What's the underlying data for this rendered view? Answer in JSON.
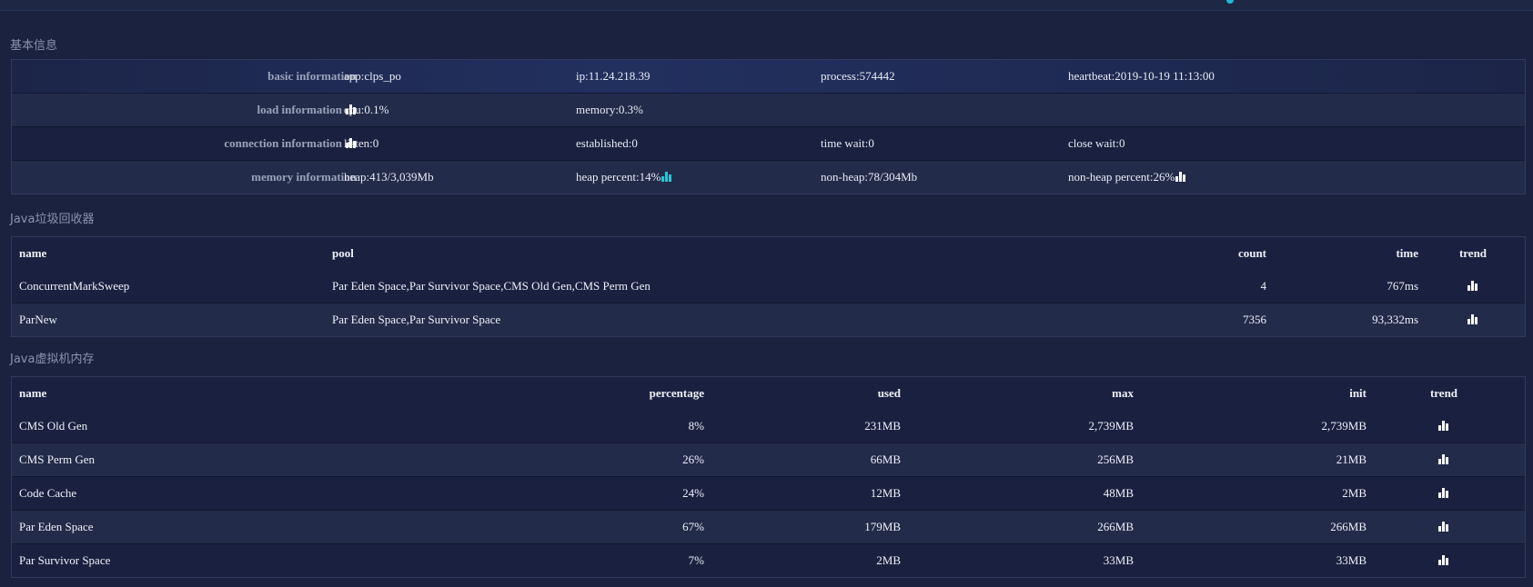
{
  "sections": {
    "basic_title": "基本信息",
    "gc_title": "Java垃圾回收器",
    "memory_title": "Java虚拟机内存"
  },
  "info": {
    "basic": {
      "label": "basic information",
      "app": "app:clps_po",
      "ip": "ip:11.24.218.39",
      "process": "process:574442",
      "heartbeat": "heartbeat:2019-10-19 11:13:00"
    },
    "load": {
      "label": "load information",
      "cpu": "cpu:0.1%",
      "memory": "memory:0.3%"
    },
    "connection": {
      "label": "connection information",
      "listen": "listen:0",
      "established": "established:0",
      "time_wait": "time wait:0",
      "close_wait": "close wait:0"
    },
    "memory": {
      "label": "memory information",
      "heap": "heap:413/3,039Mb",
      "heap_percent": "heap percent:14%",
      "non_heap": "non-heap:78/304Mb",
      "non_heap_percent": "non-heap percent:26%"
    }
  },
  "gc_table": {
    "headers": {
      "name": "name",
      "pool": "pool",
      "count": "count",
      "time": "time",
      "trend": "trend"
    },
    "rows": [
      {
        "name": "ConcurrentMarkSweep",
        "pool": "Par Eden Space,Par Survivor Space,CMS Old Gen,CMS Perm Gen",
        "count": "4",
        "time": "767ms"
      },
      {
        "name": "ParNew",
        "pool": "Par Eden Space,Par Survivor Space",
        "count": "7356",
        "time": "93,332ms"
      }
    ]
  },
  "mem_table": {
    "headers": {
      "name": "name",
      "percentage": "percentage",
      "used": "used",
      "max": "max",
      "init": "init",
      "trend": "trend"
    },
    "rows": [
      {
        "name": "CMS Old Gen",
        "percentage": "8%",
        "used": "231MB",
        "max": "2,739MB",
        "init": "2,739MB"
      },
      {
        "name": "CMS Perm Gen",
        "percentage": "26%",
        "used": "66MB",
        "max": "256MB",
        "init": "21MB"
      },
      {
        "name": "Code Cache",
        "percentage": "24%",
        "used": "12MB",
        "max": "48MB",
        "init": "2MB"
      },
      {
        "name": "Par Eden Space",
        "percentage": "67%",
        "used": "179MB",
        "max": "266MB",
        "init": "266MB"
      },
      {
        "name": "Par Survivor Space",
        "percentage": "7%",
        "used": "2MB",
        "max": "33MB",
        "init": "33MB"
      }
    ]
  },
  "colors": {
    "background": "#1b2240",
    "accent_cyan": "#22c7d4",
    "text": "#eef1f8",
    "label_muted": "#9aa3bb"
  },
  "icons": {
    "trend": "bar-chart-icon"
  }
}
